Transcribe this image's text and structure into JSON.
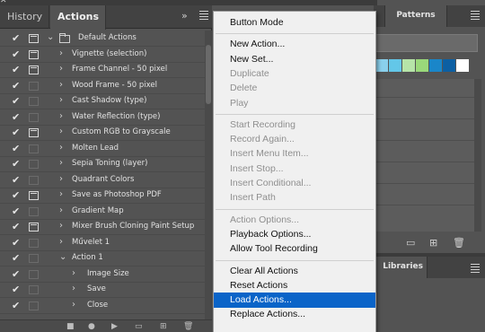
{
  "left_panel": {
    "tabs": [
      "History",
      "Actions"
    ],
    "collapse_glyph": "»",
    "rows": [
      {
        "label": "Default Actions",
        "checked": true,
        "dialog": true,
        "folder": true,
        "expanded": true,
        "indent": 0
      },
      {
        "label": "Vignette (selection)",
        "checked": true,
        "dialog": true,
        "folder": false,
        "expanded": false,
        "indent": 1
      },
      {
        "label": "Frame Channel - 50 pixel",
        "checked": true,
        "dialog": true,
        "folder": false,
        "expanded": false,
        "indent": 1
      },
      {
        "label": "Wood Frame - 50 pixel",
        "checked": true,
        "dialog": false,
        "folder": false,
        "expanded": false,
        "indent": 1
      },
      {
        "label": "Cast Shadow (type)",
        "checked": true,
        "dialog": false,
        "folder": false,
        "expanded": false,
        "indent": 1
      },
      {
        "label": "Water Reflection (type)",
        "checked": true,
        "dialog": false,
        "folder": false,
        "expanded": false,
        "indent": 1
      },
      {
        "label": "Custom RGB to Grayscale",
        "checked": true,
        "dialog": true,
        "folder": false,
        "expanded": false,
        "indent": 1
      },
      {
        "label": "Molten Lead",
        "checked": true,
        "dialog": false,
        "folder": false,
        "expanded": false,
        "indent": 1
      },
      {
        "label": "Sepia Toning (layer)",
        "checked": true,
        "dialog": false,
        "folder": false,
        "expanded": false,
        "indent": 1
      },
      {
        "label": "Quadrant Colors",
        "checked": true,
        "dialog": false,
        "folder": false,
        "expanded": false,
        "indent": 1
      },
      {
        "label": "Save as Photoshop PDF",
        "checked": true,
        "dialog": true,
        "folder": false,
        "expanded": false,
        "indent": 1
      },
      {
        "label": "Gradient Map",
        "checked": true,
        "dialog": false,
        "folder": false,
        "expanded": false,
        "indent": 1
      },
      {
        "label": "Mixer Brush Cloning Paint Setup",
        "checked": true,
        "dialog": true,
        "folder": false,
        "expanded": false,
        "indent": 1
      },
      {
        "label": "Művelet 1",
        "checked": true,
        "dialog": false,
        "folder": false,
        "expanded": false,
        "indent": 1
      },
      {
        "label": "Action 1",
        "checked": true,
        "dialog": false,
        "folder": false,
        "expanded": true,
        "indent": 1
      },
      {
        "label": "Image Size",
        "checked": true,
        "dialog": false,
        "folder": false,
        "expanded": false,
        "indent": 2
      },
      {
        "label": "Save",
        "checked": true,
        "dialog": false,
        "folder": false,
        "expanded": false,
        "indent": 2
      },
      {
        "label": "Close",
        "checked": true,
        "dialog": false,
        "folder": false,
        "expanded": false,
        "indent": 2
      }
    ],
    "bottom_icons": [
      "stop-icon",
      "record-icon",
      "play-icon",
      "new-set-icon",
      "new-action-icon",
      "trash-icon"
    ]
  },
  "right_panel": {
    "tab_patterns": "Patterns",
    "tab_libraries": "Libraries",
    "swatches": [
      "#8ad0ec",
      "#63c7e8",
      "#b6e4a8",
      "#9ad97a",
      "#1a86c9",
      "#0c5fa3",
      "#ffffff"
    ]
  },
  "menu": {
    "items": [
      {
        "label": "Button Mode",
        "enabled": true,
        "sep_before": false
      },
      {
        "label": "New Action...",
        "enabled": true,
        "sep_before": true
      },
      {
        "label": "New Set...",
        "enabled": true,
        "sep_before": false
      },
      {
        "label": "Duplicate",
        "enabled": false,
        "sep_before": false
      },
      {
        "label": "Delete",
        "enabled": false,
        "sep_before": false
      },
      {
        "label": "Play",
        "enabled": false,
        "sep_before": false
      },
      {
        "label": "Start Recording",
        "enabled": false,
        "sep_before": true
      },
      {
        "label": "Record Again...",
        "enabled": false,
        "sep_before": false
      },
      {
        "label": "Insert Menu Item...",
        "enabled": false,
        "sep_before": false
      },
      {
        "label": "Insert Stop...",
        "enabled": false,
        "sep_before": false
      },
      {
        "label": "Insert Conditional...",
        "enabled": false,
        "sep_before": false
      },
      {
        "label": "Insert Path",
        "enabled": false,
        "sep_before": false
      },
      {
        "label": "Action Options...",
        "enabled": false,
        "sep_before": true
      },
      {
        "label": "Playback Options...",
        "enabled": true,
        "sep_before": false
      },
      {
        "label": "Allow Tool Recording",
        "enabled": true,
        "sep_before": false
      },
      {
        "label": "Clear All Actions",
        "enabled": true,
        "sep_before": true
      },
      {
        "label": "Reset Actions",
        "enabled": true,
        "sep_before": false
      },
      {
        "label": "Load Actions...",
        "enabled": true,
        "sep_before": false,
        "highlighted": true
      },
      {
        "label": "Replace Actions...",
        "enabled": true,
        "sep_before": false
      }
    ]
  }
}
